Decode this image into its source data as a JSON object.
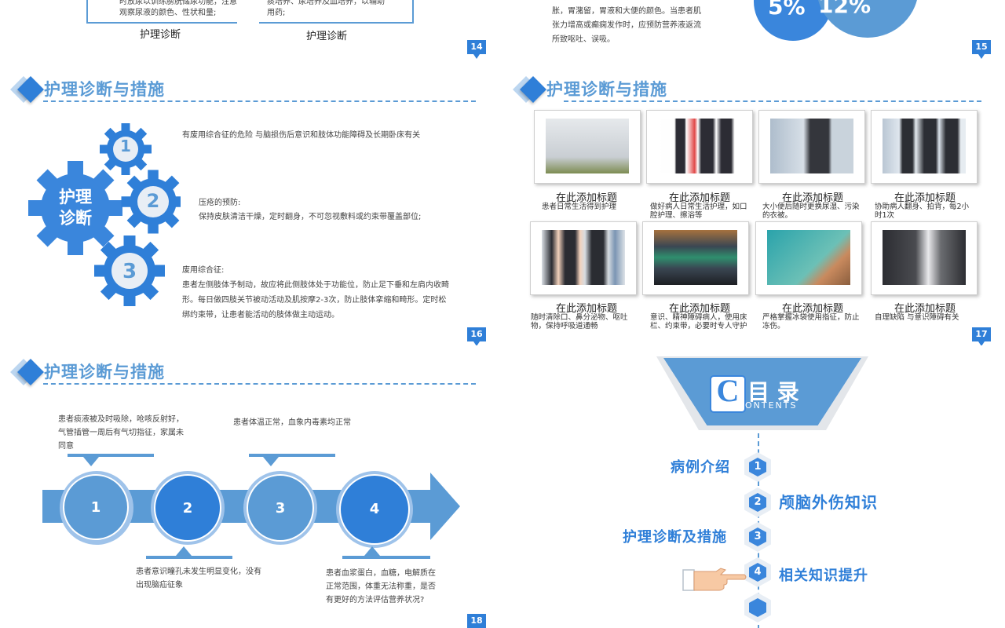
{
  "colors": {
    "accent": "#2f7fd8",
    "light": "#5b9bd5",
    "pale": "#bcd6f0"
  },
  "s14": {
    "left_text": "时放尿以训练膀胱储尿功能，注意观察尿液的颜色、性状和量;",
    "left_label": "护理诊断",
    "right_text": "痰培养、尿培养及血培养，以辅助用药;",
    "right_label": "护理诊断",
    "page": "14"
  },
  "s15": {
    "text": "质），避免嘴手伸懒时，观察患者有无腹胀，胃潴留，胃液和大便的颜色。当患者肌张力增高或癫痫发作时，应预防营养液返流所致呕吐、误吸。",
    "pct1": "5%",
    "pct2": "12%",
    "page": "15"
  },
  "s16": {
    "title": "护理诊断与措施",
    "center_line1": "护理",
    "center_line2": "诊断",
    "gears": [
      "1",
      "2",
      "3"
    ],
    "item1": "有废用综合征的危险 与脑损伤后意识和肢体功能障碍及长期卧床有关",
    "item2_head": "压疮的预防:",
    "item2_body": "保持皮肤清洁干燥，定时翻身，不可忽视敷料或约束带覆盖部位;",
    "item3_head": "废用综合征:",
    "item3_body": "患者左侧肢体予制动，故应将此侧肢体处于功能位，防止足下垂和左肩内收畸形。每日做四肢关节被动活动及肌按摩2-3次，防止肢体挛缩和畸形。定时松绑约束带，让患者能活动的肢体做主动运动。",
    "page": "16"
  },
  "s17": {
    "title": "护理诊断与措施",
    "cards": [
      {
        "title": "在此添加标题",
        "desc": "患者日常生活得到护理"
      },
      {
        "title": "在此添加标题",
        "desc": "做好病人日常生活护理，如口腔护理、擦浴等"
      },
      {
        "title": "在此添加标题",
        "desc": "大小便后随时更换尿湿、污染的衣被。"
      },
      {
        "title": "在此添加标题",
        "desc": "协助病人翻身、拍背，每2小时1次"
      },
      {
        "title": "在此添加标题",
        "desc": "随时清除口、鼻分泌物、呕吐物，保持呼吸道通畅"
      },
      {
        "title": "在此添加标题",
        "desc": "意识、精神障碍病人，使用床栏、约束带，必要时专人守护"
      },
      {
        "title": "在此添加标题",
        "desc": "严格掌握冰袋使用指征，防止冻伤。"
      },
      {
        "title": "在此添加标题",
        "desc": "自理缺陷 与意识障碍有关"
      }
    ],
    "page": "17"
  },
  "s18": {
    "title": "护理诊断与措施",
    "circles": [
      "1",
      "2",
      "3",
      "4"
    ],
    "note1": "患者痰液被及时吸除，呛咳反射好，气管插管一周后有气切指征，家属未同意",
    "note2": "患者意识瞳孔未发生明显变化，没有出现脑疝征象",
    "note3": "患者体温正常，血象内毒素均正常",
    "note4": "患者血浆蛋白，血糖，电解质在正常范围，体重无法称重，是否有更好的方法评估营养状况?",
    "page": "18"
  },
  "s19": {
    "logo_letter": "C",
    "heading": "目 录",
    "sub": "ONTENTS",
    "items": [
      {
        "num": "1",
        "label": "病例介绍"
      },
      {
        "num": "2",
        "label": "颅脑外伤知识"
      },
      {
        "num": "3",
        "label": "护理诊断及措施"
      },
      {
        "num": "4",
        "label": "相关知识提升"
      }
    ]
  }
}
